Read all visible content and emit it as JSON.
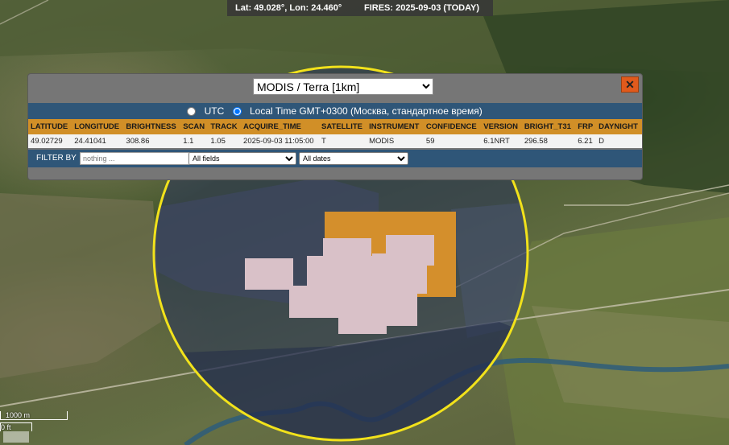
{
  "topbar": {
    "coordinates": "Lat: 49.028°, Lon: 24.460°",
    "fires": "FIRES: 2025-09-03 (TODAY)"
  },
  "popup": {
    "sensor_options": [
      "MODIS / Terra [1km]"
    ],
    "sensor_selected": "MODIS / Terra [1km]",
    "close_label": "✕",
    "timezone": {
      "utc_label": "UTC",
      "local_label": "Local Time GMT+0300 (Москва, стандартное время)",
      "selected": "local"
    },
    "table": {
      "headers": [
        "LATITUDE",
        "LONGITUDE",
        "BRIGHTNESS",
        "SCAN",
        "TRACK",
        "ACQUIRE_TIME",
        "SATELLITE",
        "INSTRUMENT",
        "CONFIDENCE",
        "VERSION",
        "BRIGHT_T31",
        "FRP",
        "DAYNIGHT"
      ],
      "rows": [
        [
          "49.02729",
          "24.41041",
          "308.86",
          "1.1",
          "1.05",
          "2025-09-03 11:05:00",
          "T",
          "MODIS",
          "59",
          "6.1NRT",
          "296.58",
          "6.21",
          "D"
        ]
      ]
    },
    "filter": {
      "label": "FILTER BY",
      "placeholder": "nothing ...",
      "field_selected": "All fields",
      "date_selected": "All dates"
    }
  },
  "map": {
    "highlight_color": "#f2e21b",
    "fire_pixel_color": "#d48f2c",
    "selected_pixel_color": "#d9c1c8"
  },
  "scale": {
    "metric": "1000 m",
    "imperial": "0 ft"
  }
}
